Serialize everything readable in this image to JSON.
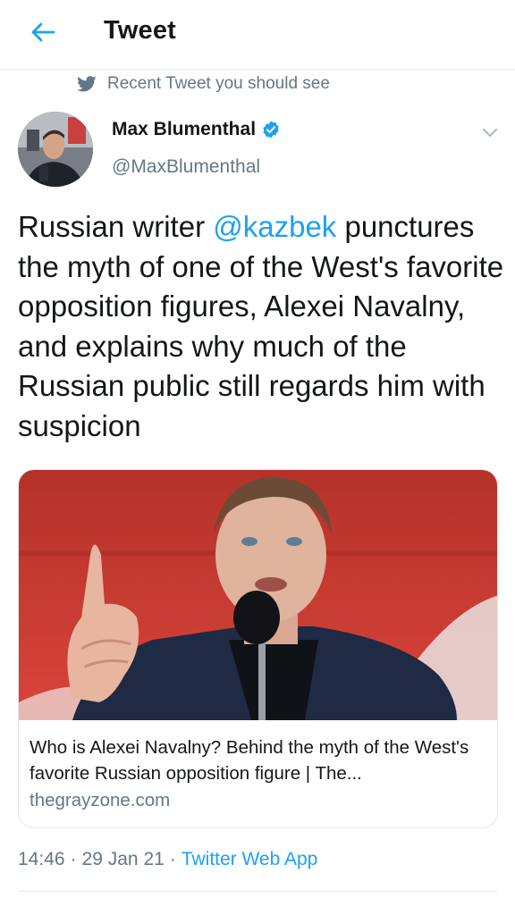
{
  "header": {
    "title": "Tweet",
    "back_icon": "arrow-left-icon"
  },
  "context": {
    "label": "Recent Tweet you should see",
    "icon": "twitter-bird-icon"
  },
  "author": {
    "name": "Max Blumenthal",
    "handle": "@MaxBlumenthal",
    "verified": true
  },
  "tweet": {
    "text_before": "Russian writer ",
    "mention": "@kazbek",
    "text_after": " punctures the myth of one of the West's favorite opposition figures, Alexei Navalny, and explains why much of the Russian public still regards him with suspicion"
  },
  "card": {
    "title": "Who is Alexei Navalny? Behind the myth of the West's favorite Russian opposition figure | The...",
    "domain": "thegrayzone.com"
  },
  "meta": {
    "time": "14:46",
    "date": "29 Jan 21",
    "separator": "·",
    "app": "Twitter Web App"
  },
  "colors": {
    "accent": "#1da1f2",
    "secondary_text": "#657786",
    "primary_text": "#14171a"
  }
}
